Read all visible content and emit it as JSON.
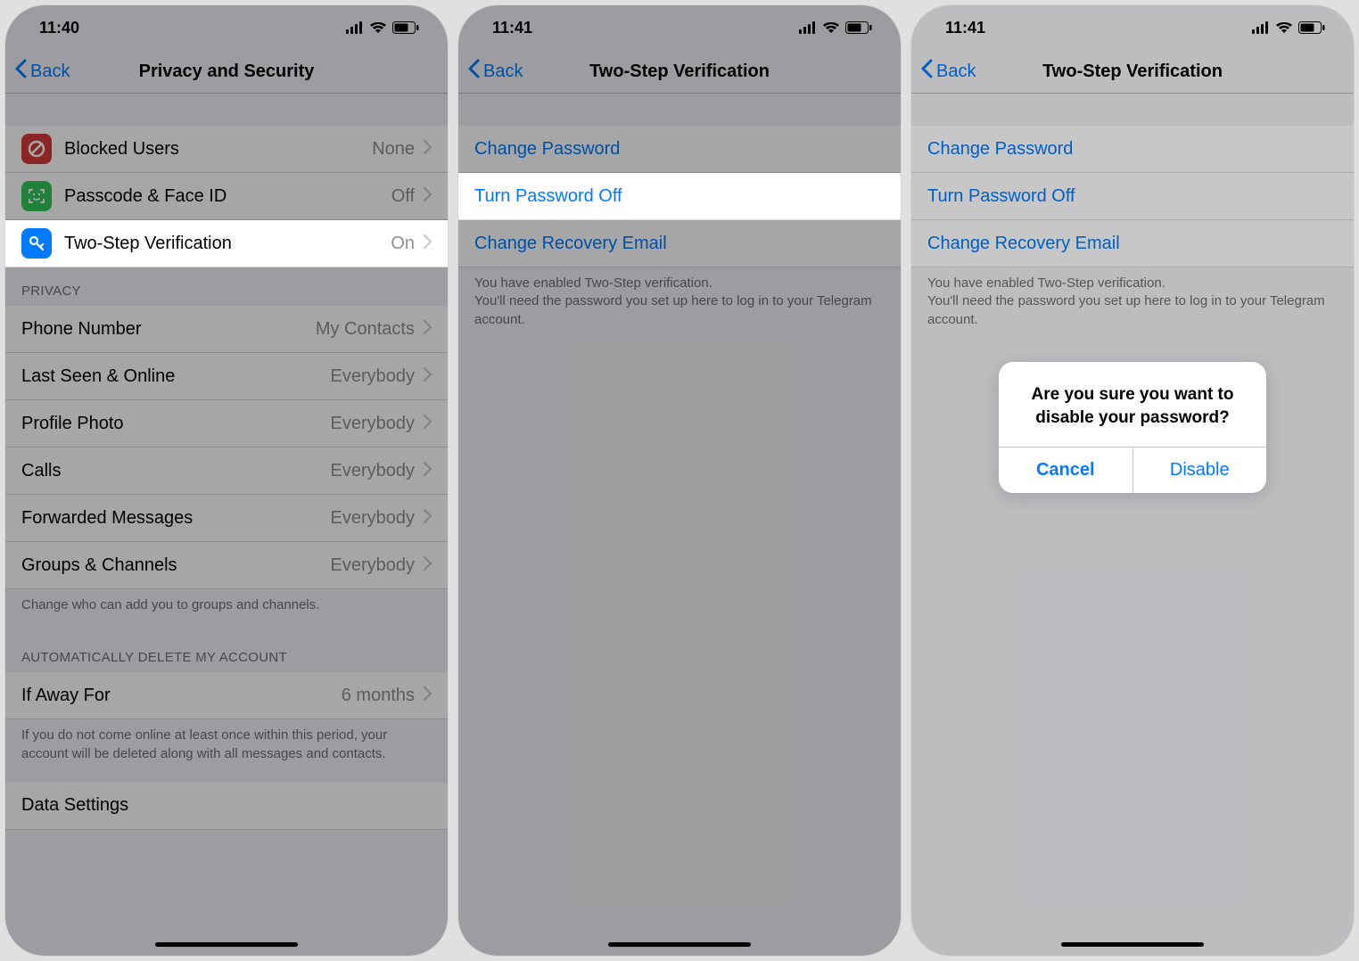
{
  "screens": [
    {
      "time": "11:40",
      "back": "Back",
      "title": "Privacy and Security",
      "security": [
        {
          "icon_name": "block-icon",
          "icon_bg": "#d83b3b",
          "label": "Blocked Users",
          "value": "None"
        },
        {
          "icon_name": "faceid-icon",
          "icon_bg": "#34c759",
          "label": "Passcode & Face ID",
          "value": "Off"
        },
        {
          "icon_name": "key-icon",
          "icon_bg": "#007aff",
          "label": "Two-Step Verification",
          "value": "On"
        }
      ],
      "privacy_header": "PRIVACY",
      "privacy": [
        {
          "label": "Phone Number",
          "value": "My Contacts"
        },
        {
          "label": "Last Seen & Online",
          "value": "Everybody"
        },
        {
          "label": "Profile Photo",
          "value": "Everybody"
        },
        {
          "label": "Calls",
          "value": "Everybody"
        },
        {
          "label": "Forwarded Messages",
          "value": "Everybody"
        },
        {
          "label": "Groups & Channels",
          "value": "Everybody"
        }
      ],
      "privacy_footer": "Change who can add you to groups and channels.",
      "auto_delete_header": "AUTOMATICALLY DELETE MY ACCOUNT",
      "auto_delete": {
        "label": "If Away For",
        "value": "6 months"
      },
      "auto_delete_footer": "If you do not come online at least once within this period, your account will be deleted along with all messages and contacts.",
      "data_settings_label": "Data Settings"
    },
    {
      "time": "11:41",
      "back": "Back",
      "title": "Two-Step Verification",
      "rows": [
        {
          "label": "Change Password"
        },
        {
          "label": "Turn Password Off"
        },
        {
          "label": "Change Recovery Email"
        }
      ],
      "footer": "You have enabled Two-Step verification.\nYou'll need the password you set up here to log in to your Telegram account."
    },
    {
      "time": "11:41",
      "back": "Back",
      "title": "Two-Step Verification",
      "rows": [
        {
          "label": "Change Password"
        },
        {
          "label": "Turn Password Off"
        },
        {
          "label": "Change Recovery Email"
        }
      ],
      "footer": "You have enabled Two-Step verification.\nYou'll need the password you set up here to log in to your Telegram account.",
      "alert": {
        "message": "Are you sure you want to disable your password?",
        "cancel": "Cancel",
        "confirm": "Disable"
      }
    }
  ]
}
